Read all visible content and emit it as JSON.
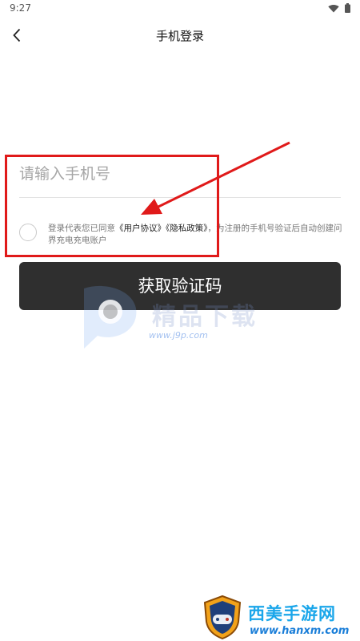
{
  "status_bar": {
    "time": "9:27"
  },
  "nav": {
    "title": "手机登录"
  },
  "form": {
    "phone_placeholder": "请输入手机号",
    "agreement": {
      "prefix": "登录代表您已同意",
      "user_agreement": "《用户协议》",
      "privacy_policy": "《隐私政策》",
      "suffix": "，为注册的手机号验证后自动创建问界充电充电账户"
    },
    "submit_label": "获取验证码"
  },
  "watermarks": {
    "center_name": "精品下载",
    "center_url": "www.j9p.com",
    "bottom_name": "西美手游网",
    "bottom_url": "www.hanxm.com"
  },
  "colors": {
    "button_bg": "#2f2f2f",
    "annotation": "#e01a1a"
  }
}
